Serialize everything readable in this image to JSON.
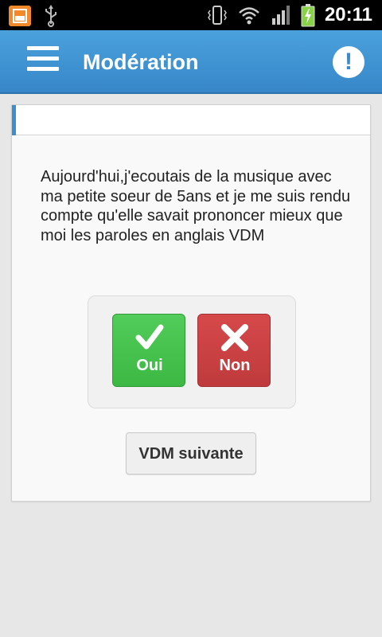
{
  "status_bar": {
    "time": "20:11",
    "icons": [
      "app-notification-icon",
      "usb-icon",
      "vibrate-icon",
      "wifi-icon",
      "signal-icon",
      "battery-charging-icon"
    ]
  },
  "action_bar": {
    "title": "Modération",
    "menu_icon": "hamburger-menu-icon",
    "alert_icon": "exclamation-icon",
    "alert_glyph": "!",
    "color": "#3f94d3"
  },
  "card": {
    "story": "Aujourd'hui,j'ecoutais de la musique avec ma petite soeur de 5ans et je me suis rendu compte qu'elle savait prononcer mieux que moi les paroles en anglais VDM"
  },
  "vote": {
    "yes_label": "Oui",
    "no_label": "Non",
    "yes_icon": "check-icon",
    "no_icon": "cross-icon",
    "yes_color": "#45c04c",
    "no_color": "#cb4143"
  },
  "next_button_label": "VDM suivante"
}
